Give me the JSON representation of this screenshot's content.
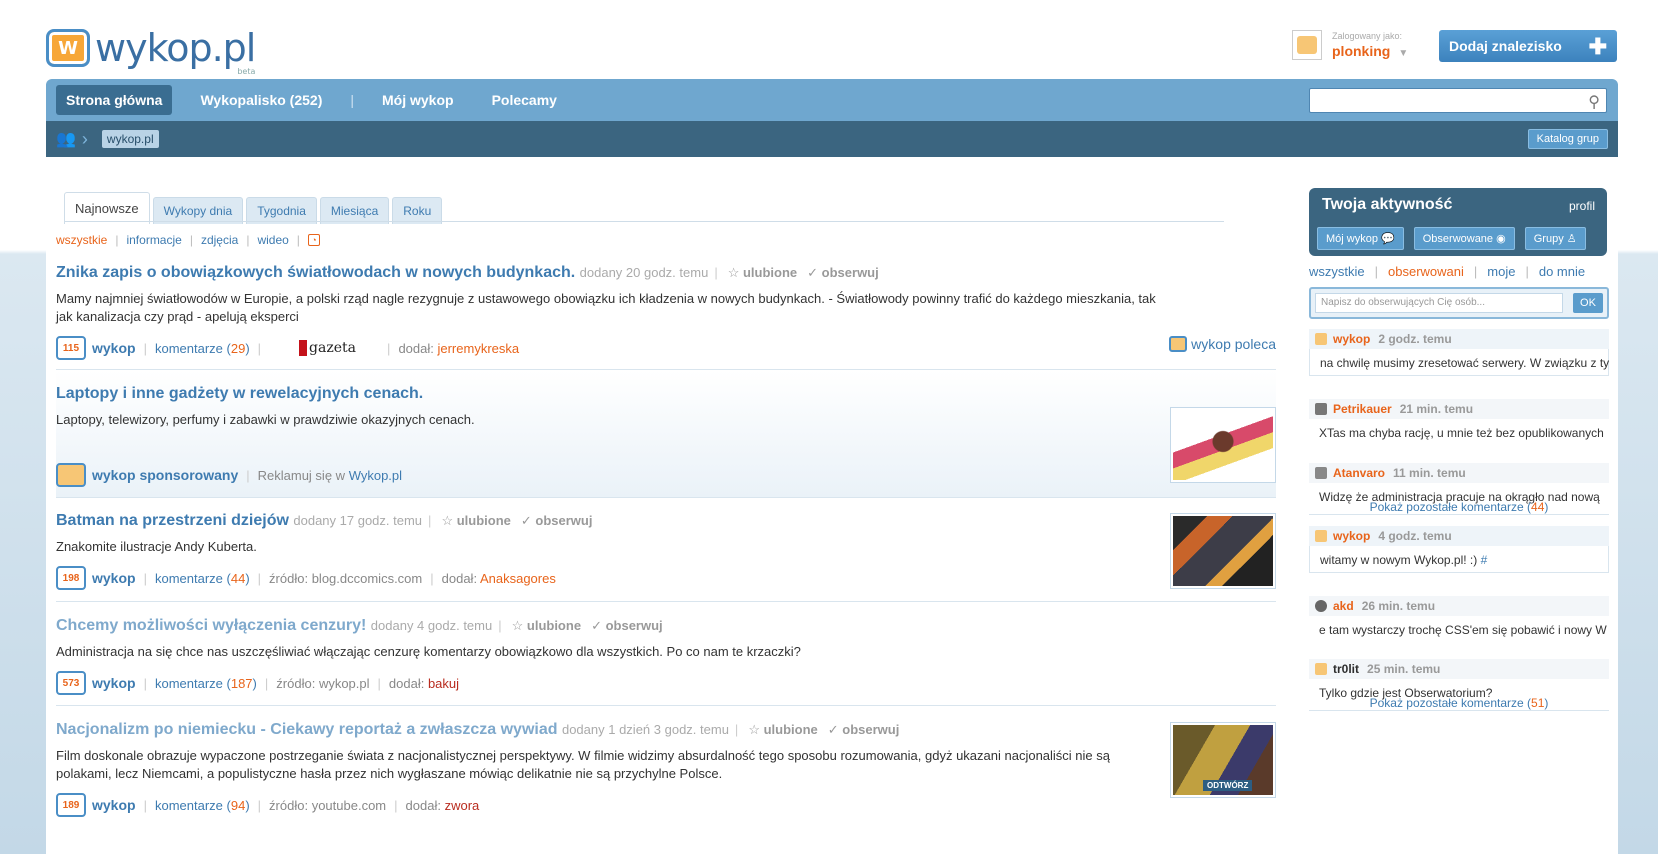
{
  "header": {
    "logo_text": "wykop.pl",
    "logo_beta": "beta",
    "logged_label": "Zalogowany jako:",
    "username": "plonking",
    "add_button": "Dodaj znalezisko"
  },
  "nav": {
    "items": [
      "Strona główna",
      "Wykopalisko (252)",
      "Mój wykop",
      "Polecamy"
    ],
    "search_placeholder": ""
  },
  "subbar": {
    "breadcrumb": "wykop.pl",
    "catalog_button": "Katalog grup"
  },
  "tabs": [
    "Najnowsze",
    "Wykopy dnia",
    "Tygodnia",
    "Miesiąca",
    "Roku"
  ],
  "filters": [
    "wszystkie",
    "informacje",
    "zdjęcia",
    "wideo"
  ],
  "common": {
    "wykop": "wykop",
    "comments": "komentarze",
    "favorite": "ulubione",
    "observe": "obserwuj",
    "added_by": "dodał:",
    "source": "źródło:"
  },
  "entries": [
    {
      "title": "Znika zapis o obowiązkowych światłowodach w nowych budynkach.",
      "added": "dodany 20 godz. temu",
      "desc": "Mamy najmniej światłowodów w Europie, a polski rząd nagle rezygnuje z ustawowego obowiązku ich kładzenia w nowych budynkach. - Światłowody powinny trafić do każdego mieszkania, tak jak kanalizacja czy prąd - apelują eksperci",
      "count": "115",
      "comments": "29",
      "source_logo": "gazeta",
      "user": "jerremykreska",
      "recommend": "wykop poleca"
    },
    {
      "title": "Laptopy i inne gadżety w rewelacyjnych cenach.",
      "desc": "Laptopy, telewizory, perfumy i zabawki w prawdziwie okazyjnych cenach.",
      "sponsored": "wykop sponsorowany",
      "advertise": "Reklamuj się w",
      "advertise_link": "Wykop.pl"
    },
    {
      "title": "Batman na przestrzeni dziejów",
      "added": "dodany 17 godz. temu",
      "desc": "Znakomite ilustracje Andy Kuberta.",
      "count": "198",
      "comments": "44",
      "source": "blog.dccomics.com",
      "user": "Anaksagores"
    },
    {
      "title": "Chcemy możliwości wyłączenia cenzury!",
      "added": "dodany 4 godz. temu",
      "desc": "Administracja na się chce nas uszczęśliwiać włączając cenzurę komentarzy obowiązkowo dla wszystkich. Po co nam te krzaczki?",
      "count": "573",
      "comments": "187",
      "source": "wykop.pl",
      "user": "bakuj"
    },
    {
      "title": "Nacjonalizm po niemiecku - Ciekawy reportaż a zwłaszcza wywiad",
      "added": "dodany 1 dzień 3 godz. temu",
      "desc": "Film doskonale obrazuje wypaczone postrzeganie świata z nacjonalistycznej perspektywy. W filmie widzimy absurdalność tego sposobu rozumowania, gdyż ukazani nacjonaliści nie są polakami, lecz Niemcami, a populistyczne hasła przez nich wygłaszane mówiąc delikatnie nie są przychylne Polsce.",
      "count": "189",
      "comments": "94",
      "source": "youtube.com",
      "user": "zwora",
      "thumb_label": "ODTWÓRZ"
    }
  ],
  "sidebar": {
    "title": "Twoja aktywność",
    "profile": "profil",
    "buttons": [
      "Mój wykop",
      "Obserwowane",
      "Grupy"
    ],
    "filters": [
      "wszystkie",
      "obserwowani",
      "moje",
      "do mnie"
    ],
    "input_placeholder": "Napisz do obserwujących Cię osób...",
    "ok": "OK",
    "show_more": "Pokaż pozostałe komentarze",
    "items": [
      {
        "user": "wykop",
        "time": "2 godz. temu",
        "text": "na chwilę musimy zresetować serwery. W związku z tym"
      },
      {
        "user": "Petrikauer",
        "time": "21 min. temu",
        "text": "XTas ma chyba rację, u mnie też bez opublikowanych"
      },
      {
        "user": "Atanvaro",
        "time": "11 min. temu",
        "text": "Widzę że administracja pracuje na okrągło nad nową",
        "more": "44"
      },
      {
        "user": "wykop",
        "time": "4 godz. temu",
        "text": "witamy w nowym Wykop.pl! :)",
        "link": "#"
      },
      {
        "user": "akd",
        "time": "26 min. temu",
        "text": "e tam wystarczy trochę CSS'em się pobawić i nowy W"
      },
      {
        "user": "tr0lit",
        "time": "25 min. temu",
        "text": "Tylko gdzie jest Obserwatorium?",
        "more": "51"
      }
    ]
  },
  "colors": {
    "brand_blue": "#3e7bb0",
    "accent_orange": "#e8641b",
    "nav_bg": "#6fa7cf",
    "dark_bar": "#3b6580"
  }
}
